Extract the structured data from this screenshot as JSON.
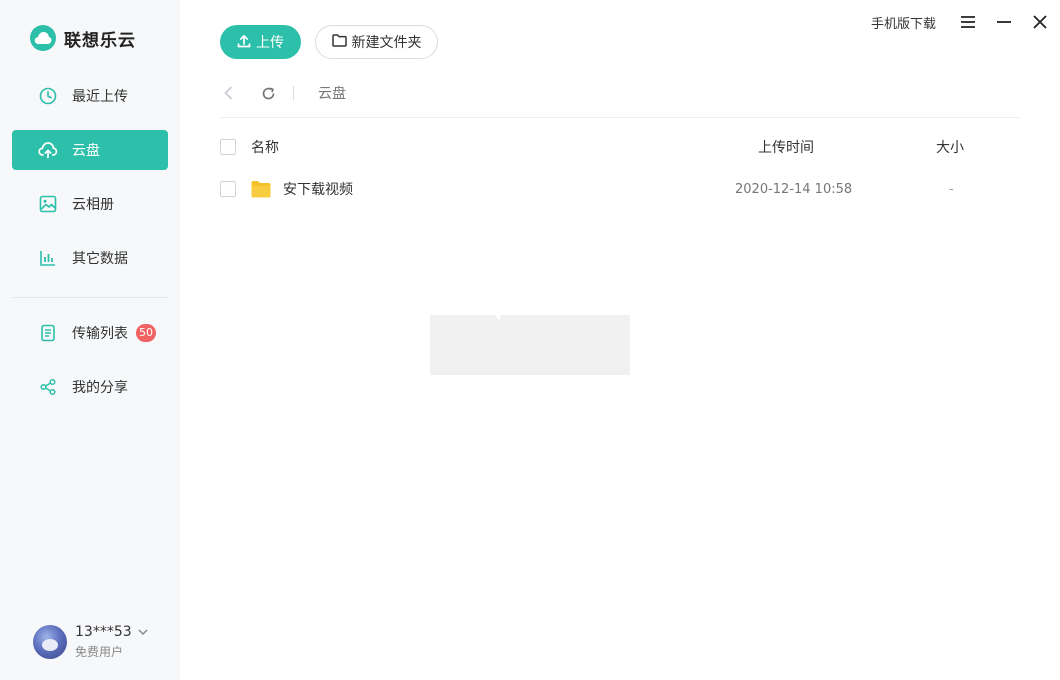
{
  "app": {
    "name": "联想乐云",
    "brand_color": "#2cbfa9"
  },
  "sidebar": {
    "items": [
      {
        "label": "最近上传",
        "icon": "clock-icon"
      },
      {
        "label": "云盘",
        "icon": "cloud-upload-icon",
        "active": true
      },
      {
        "label": "云相册",
        "icon": "image-icon"
      },
      {
        "label": "其它数据",
        "icon": "bar-chart-icon"
      }
    ],
    "items2": [
      {
        "label": "传输列表",
        "icon": "document-icon",
        "badge": "50"
      },
      {
        "label": "我的分享",
        "icon": "share-icon"
      }
    ]
  },
  "user": {
    "name": "13***53",
    "type": "免费用户"
  },
  "toolbar": {
    "upload_label": "上传",
    "new_folder_label": "新建文件夹"
  },
  "topbar": {
    "mobile_download": "手机版下载"
  },
  "breadcrumb": {
    "current": "云盘"
  },
  "table": {
    "headers": {
      "name": "名称",
      "time": "上传时间",
      "size": "大小"
    },
    "rows": [
      {
        "name": "安下载视频",
        "time": "2020-12-14 10:58",
        "size": "-",
        "type": "folder"
      }
    ]
  }
}
